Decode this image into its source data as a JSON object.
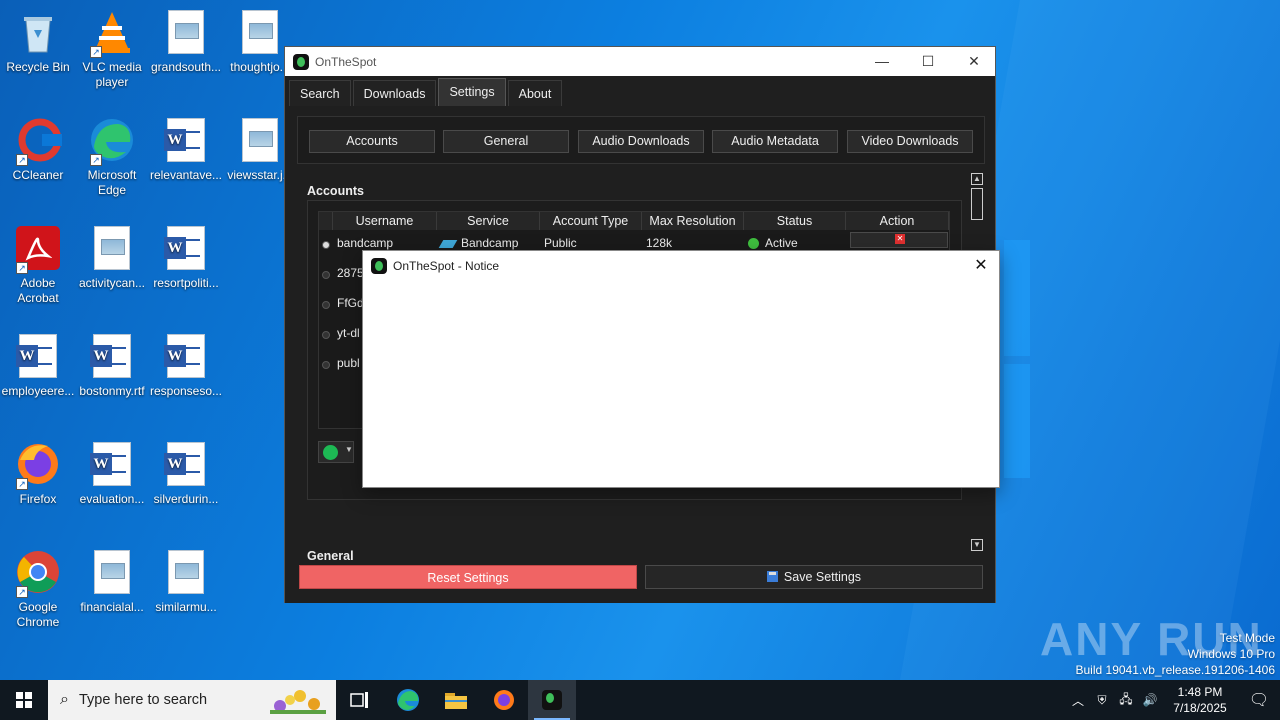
{
  "desktop": {
    "icons": [
      {
        "label": "Recycle Bin",
        "icon": "recycle-bin-icon"
      },
      {
        "label": "VLC media player",
        "icon": "vlc-icon"
      },
      {
        "label": "grandsouth...",
        "icon": "image-file-icon"
      },
      {
        "label": "thoughtjo...",
        "icon": "image-file-icon"
      },
      {
        "label": "CCleaner",
        "icon": "ccleaner-icon"
      },
      {
        "label": "Microsoft Edge",
        "icon": "edge-icon"
      },
      {
        "label": "relevantave...",
        "icon": "word-file-icon"
      },
      {
        "label": "viewsstar.j...",
        "icon": "image-file-icon"
      },
      {
        "label": "Adobe Acrobat",
        "icon": "acrobat-icon"
      },
      {
        "label": "activitycan...",
        "icon": "image-file-icon"
      },
      {
        "label": "resortpoliti...",
        "icon": "word-file-icon"
      },
      {
        "label": "employeere...",
        "icon": "word-file-icon"
      },
      {
        "label": "bostonmy.rtf",
        "icon": "word-file-icon"
      },
      {
        "label": "responseso...",
        "icon": "word-file-icon"
      },
      {
        "label": "Firefox",
        "icon": "firefox-icon"
      },
      {
        "label": "evaluation...",
        "icon": "word-file-icon"
      },
      {
        "label": "silverdurin...",
        "icon": "word-file-icon"
      },
      {
        "label": "Google Chrome",
        "icon": "chrome-icon"
      },
      {
        "label": "financialal...",
        "icon": "image-file-icon"
      },
      {
        "label": "similarmu...",
        "icon": "image-file-icon"
      }
    ]
  },
  "main_window": {
    "title": "OnTheSpot",
    "tabs": [
      "Search",
      "Downloads",
      "Settings",
      "About"
    ],
    "active_tab": "Settings",
    "section_buttons": [
      "Accounts",
      "General",
      "Audio Downloads",
      "Audio Metadata",
      "Video Downloads"
    ],
    "accounts_title": "Accounts",
    "general_title": "General",
    "table": {
      "headers": [
        "Username",
        "Service",
        "Account Type",
        "Max Resolution",
        "Status",
        "Action"
      ],
      "rows": [
        {
          "username": "bandcamp",
          "service": "Bandcamp",
          "account_type": "Public",
          "max_resolution": "128k",
          "status": "Active"
        },
        {
          "username": "2875",
          "service": "",
          "account_type": "",
          "max_resolution": "",
          "status": ""
        },
        {
          "username": "FfGd",
          "service": "",
          "account_type": "",
          "max_resolution": "",
          "status": ""
        },
        {
          "username": "yt-dl",
          "service": "",
          "account_type": "",
          "max_resolution": "",
          "status": ""
        },
        {
          "username": "publ",
          "service": "",
          "account_type": "",
          "max_resolution": "",
          "status": ""
        }
      ]
    },
    "reset_label": "Reset Settings",
    "save_label": "Save Settings"
  },
  "notice": {
    "title": "OnTheSpot - Notice"
  },
  "watermark": {
    "brand": "ANY RUN",
    "line1": "Test Mode",
    "line2": "Windows 10 Pro",
    "line3": "Build 19041.vb_release.191206-1406"
  },
  "taskbar": {
    "search_placeholder": "Type here to search",
    "time": "1:48 PM",
    "date": "7/18/2025"
  },
  "colors": {
    "reset": "#f06464",
    "active_status": "#3fbf3f",
    "spotify": "#1db954"
  }
}
